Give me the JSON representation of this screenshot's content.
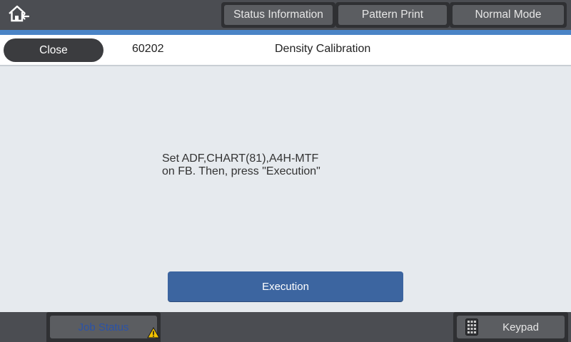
{
  "topbar": {
    "home_icon": "home-back-icon",
    "buttons": [
      "Status Information",
      "Pattern Print",
      "Normal Mode"
    ]
  },
  "header": {
    "close_label": "Close",
    "code": "60202",
    "title": "Density Calibration"
  },
  "main": {
    "message_line1": "Set ADF,CHART(81),A4H-MTF",
    "message_line2": "on FB. Then, press \"Execution\"",
    "execute_label": "Execution"
  },
  "bottombar": {
    "job_status_label": "Job Status",
    "job_status_icon": "warning-icon",
    "keypad_label": "Keypad",
    "keypad_icon": "keypad-icon"
  },
  "colors": {
    "accent": "#4a84c6",
    "execute_button": "#3c65a0",
    "job_status_text": "#2a52a8",
    "warning": "#f2c200"
  }
}
